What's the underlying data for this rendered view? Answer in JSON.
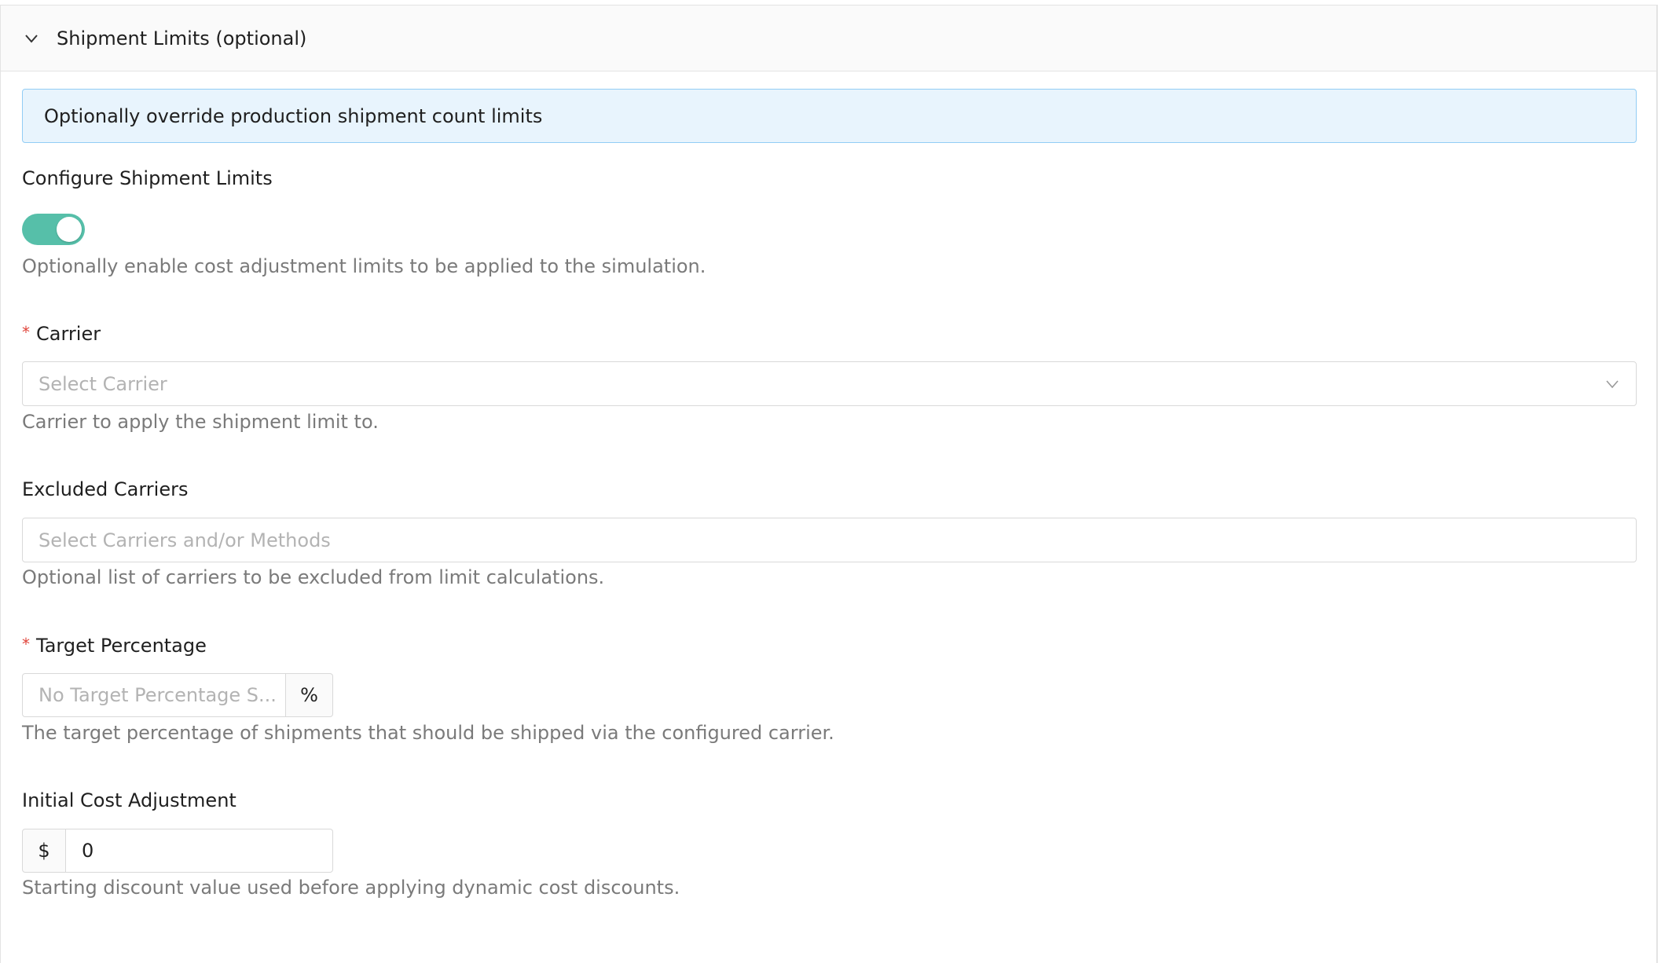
{
  "panel": {
    "title": "Shipment Limits (optional)",
    "icon": "chevron-down-icon"
  },
  "info_banner": {
    "text": "Optionally override production shipment count limits"
  },
  "configure": {
    "label": "Configure Shipment Limits",
    "toggle_on": true,
    "toggle_color": "#56bfa9",
    "help": "Optionally enable cost adjustment limits to be applied to the simulation."
  },
  "carrier": {
    "required_mark": "*",
    "label": "Carrier",
    "placeholder": "Select Carrier",
    "help": "Carrier to apply the shipment limit to."
  },
  "excluded_carriers": {
    "label": "Excluded Carriers",
    "placeholder": "Select Carriers and/or Methods",
    "help": "Optional list of carriers to be excluded from limit calculations."
  },
  "target_percentage": {
    "required_mark": "*",
    "label": "Target Percentage",
    "placeholder": "No Target Percentage S...",
    "suffix": "%",
    "help": "The target percentage of shipments that should be shipped via the configured carrier."
  },
  "initial_cost": {
    "label": "Initial Cost Adjustment",
    "prefix": "$",
    "value": "0",
    "help": "Starting discount value used before applying dynamic cost discounts."
  }
}
